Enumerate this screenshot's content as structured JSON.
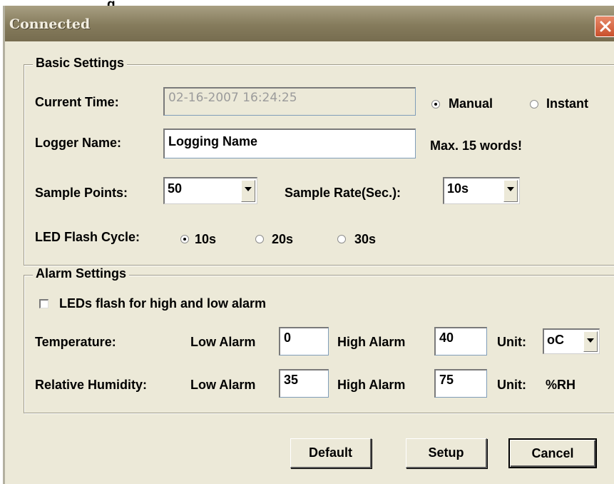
{
  "window": {
    "title": "Connected",
    "top_text": "g"
  },
  "basic": {
    "group_label": "Basic Settings",
    "current_time_label": "Current Time:",
    "current_time_value": "02-16-2007 16:24:25",
    "time_mode": {
      "manual": "Manual",
      "instant": "Instant",
      "selected": "manual"
    },
    "logger_name_label": "Logger Name:",
    "logger_name_value": "Logging Name",
    "logger_name_hint": "Max. 15 words!",
    "sample_points_label": "Sample Points:",
    "sample_points_value": "50",
    "sample_rate_label": "Sample Rate(Sec.):",
    "sample_rate_value": "10s",
    "led_flash_label": "LED Flash Cycle:",
    "led_options": [
      "10s",
      "20s",
      "30s"
    ],
    "led_selected": "10s"
  },
  "alarm": {
    "group_label": "Alarm Settings",
    "led_alarm_checkbox": "LEDs flash for high and low alarm",
    "led_alarm_checked": false,
    "temperature": {
      "label": "Temperature:",
      "low_label": "Low Alarm",
      "low_value": "0",
      "high_label": "High Alarm",
      "high_value": "40",
      "unit_label": "Unit:",
      "unit_value": "oC"
    },
    "humidity": {
      "label": "Relative Humidity:",
      "low_label": "Low Alarm",
      "low_value": "35",
      "high_label": "High Alarm",
      "high_value": "75",
      "unit_label": "Unit:",
      "unit_value": "%RH"
    }
  },
  "buttons": {
    "default": "Default",
    "setup": "Setup",
    "cancel": "Cancel"
  }
}
